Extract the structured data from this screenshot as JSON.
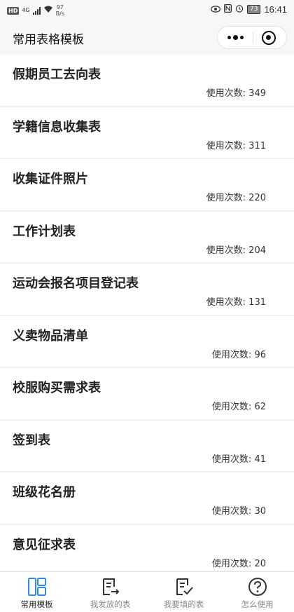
{
  "status_bar": {
    "hd": "HD",
    "network": "4G",
    "speed_value": "97",
    "speed_unit": "B/s",
    "battery": "73",
    "time": "16:41"
  },
  "header": {
    "title": "常用表格模板"
  },
  "list": {
    "count_prefix": "使用次数:",
    "items": [
      {
        "title": "假期员工去向表",
        "count": "349"
      },
      {
        "title": "学籍信息收集表",
        "count": "311"
      },
      {
        "title": "收集证件照片",
        "count": "220"
      },
      {
        "title": "工作计划表",
        "count": "204"
      },
      {
        "title": "运动会报名项目登记表",
        "count": "131"
      },
      {
        "title": "义卖物品清单",
        "count": "96"
      },
      {
        "title": "校服购买需求表",
        "count": "62"
      },
      {
        "title": "签到表",
        "count": "41"
      },
      {
        "title": "班级花名册",
        "count": "30"
      },
      {
        "title": "意见征求表",
        "count": "20"
      }
    ]
  },
  "tabbar": {
    "tabs": [
      {
        "label": "常用模板",
        "icon": "template-grid-icon",
        "active": true
      },
      {
        "label": "我发放的表",
        "icon": "form-send-icon",
        "active": false
      },
      {
        "label": "我要填的表",
        "icon": "form-check-icon",
        "active": false
      },
      {
        "label": "怎么使用",
        "icon": "help-icon",
        "active": false
      }
    ],
    "active_color": "#2f8ae8",
    "inactive_color": "#333333"
  }
}
